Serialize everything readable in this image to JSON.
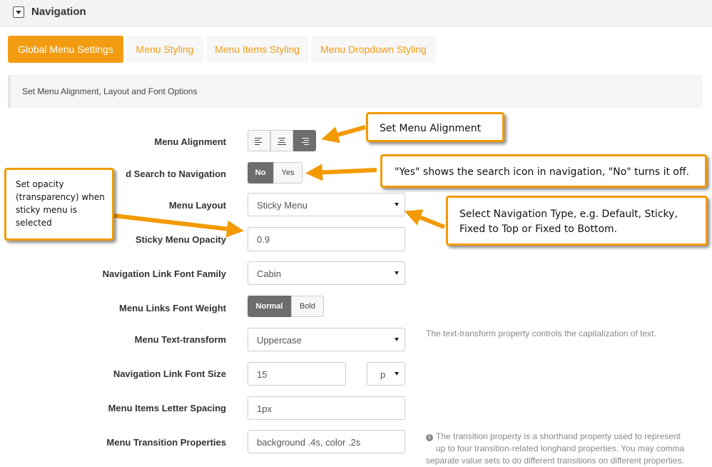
{
  "panel": {
    "title": "Navigation"
  },
  "tabs": [
    {
      "label": "Global Menu Settings",
      "active": true
    },
    {
      "label": "Menu Styling",
      "active": false
    },
    {
      "label": "Menu Items Styling",
      "active": false
    },
    {
      "label": "Menu Dropdown Styling",
      "active": false
    }
  ],
  "section": {
    "description": "Set Menu Alignment, Layout and Font Options"
  },
  "fields": {
    "menu_alignment": {
      "label": "Menu Alignment",
      "options": [
        "align-left",
        "align-center",
        "align-right"
      ],
      "selected": "align-right"
    },
    "search": {
      "label": "Add Search to Navigation",
      "visible_label": "d Search to Navigation",
      "no": "No",
      "yes": "Yes",
      "selected": "No"
    },
    "menu_layout": {
      "label": "Menu Layout",
      "value": "Sticky Menu"
    },
    "sticky_opacity": {
      "label": "Sticky Menu Opacity",
      "value": "0.9"
    },
    "font_family": {
      "label": "Navigation Link Font Family",
      "value": "Cabin"
    },
    "font_weight": {
      "label": "Menu Links Font Weight",
      "normal": "Normal",
      "bold": "Bold",
      "selected": "Normal"
    },
    "text_transform": {
      "label": "Menu Text-transform",
      "value": "Uppercase",
      "help": "The text-transform property controls the capitalization of text."
    },
    "font_size": {
      "label": "Navigation Link Font Size",
      "value": "15",
      "unit": "p"
    },
    "letter_spacing": {
      "label": "Menu Items Letter Spacing",
      "value": "1px"
    },
    "transition": {
      "label": "Menu Transition Properties",
      "value": "background .4s, color .2s",
      "help_line1": "The transition property is a shorthand property used to represent",
      "help_line2": "up to four transition-related longhand properties. You may comma",
      "help_line3": "separate value sets to do different transitions on different properties."
    }
  },
  "callouts": {
    "alignment": "Set Menu Alignment",
    "search": "\"Yes\" shows the search icon in navigation, \"No\" turns it off.",
    "layout_line1": "Select Navigation Type, e.g. Default, Sticky,",
    "layout_line2": "Fixed to Top or Fixed to Bottom.",
    "opacity_line1": "Set opacity",
    "opacity_line2": "(transparency) when",
    "opacity_line3": "sticky menu is",
    "opacity_line4": "selected"
  },
  "colors": {
    "accent": "#f39c12",
    "callout_border": "#f29a00",
    "active_button": "#6d6d6d"
  },
  "icons": {
    "collapse": "collapse-triangle-icon",
    "dropdown": "chevron-down-icon",
    "info": "info-circle-icon"
  }
}
